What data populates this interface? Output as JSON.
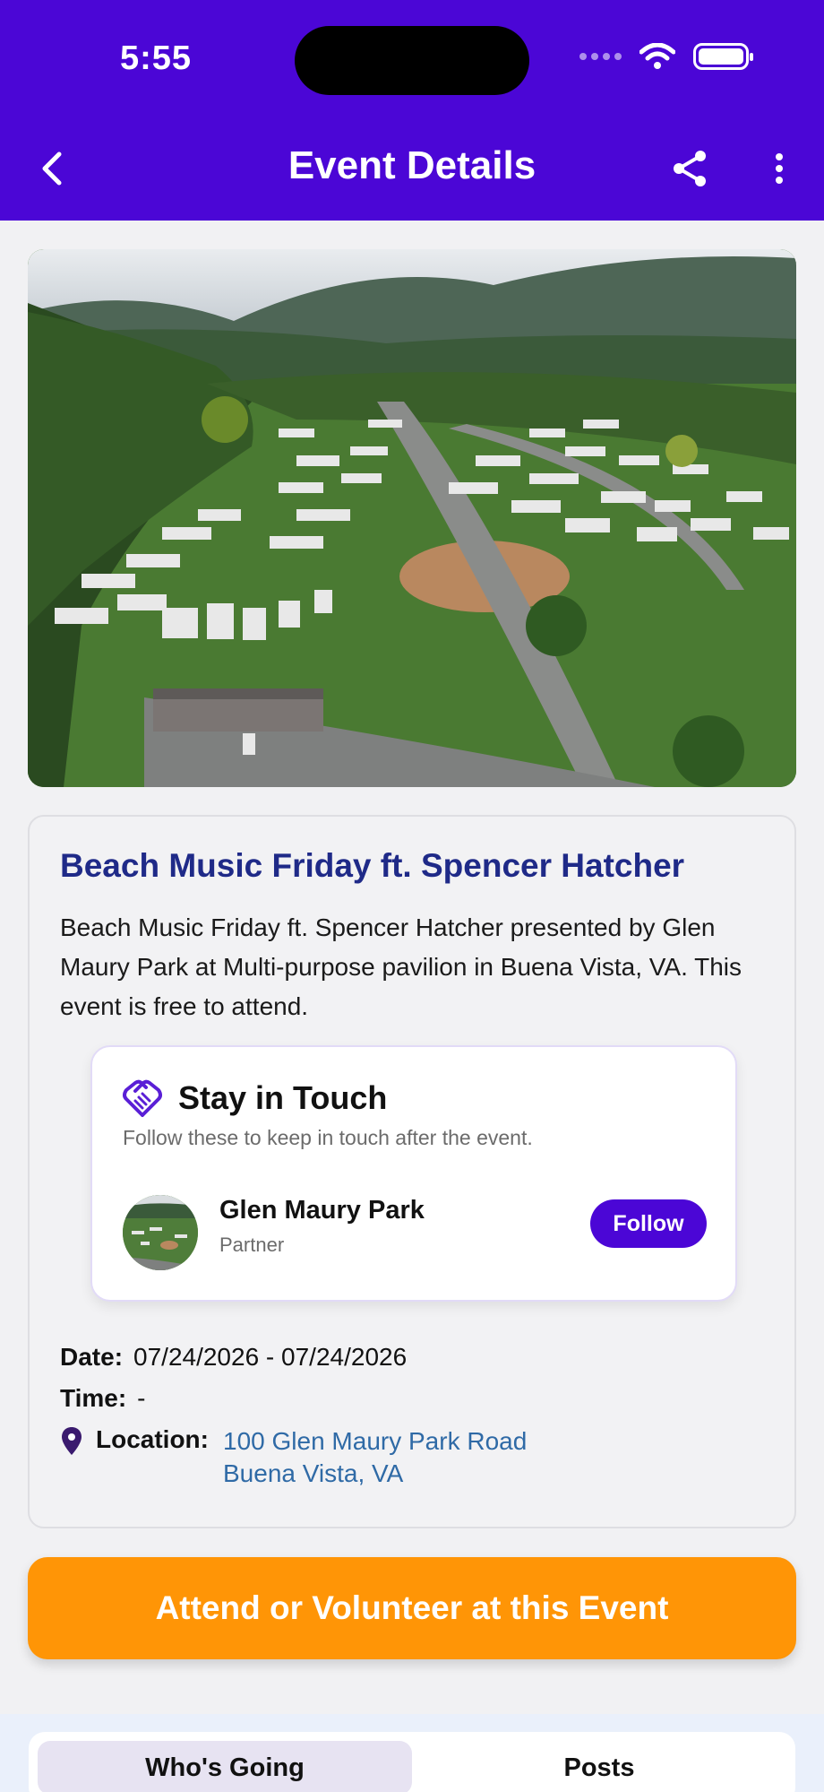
{
  "status_bar": {
    "time": "5:55"
  },
  "header": {
    "title": "Event Details"
  },
  "event": {
    "title": "Beach Music Friday ft. Spencer Hatcher",
    "description": "Beach Music Friday ft. Spencer Hatcher presented by Glen Maury Park at Multi-purpose pavilion in Buena Vista, VA. This event is free to attend."
  },
  "stay_in_touch": {
    "title": "Stay in Touch",
    "subtitle": "Follow these to keep in touch after the event.",
    "partner": {
      "name": "Glen Maury Park",
      "role": "Partner",
      "follow_label": "Follow"
    }
  },
  "details": {
    "date_label": "Date:",
    "date_value": "07/24/2026 - 07/24/2026",
    "time_label": "Time:",
    "time_value": "-",
    "location_label": "Location:",
    "location_line1": "100 Glen Maury Park Road",
    "location_line2": "Buena Vista, VA"
  },
  "cta": {
    "label": "Attend or Volunteer at this Event"
  },
  "tabs": [
    {
      "label": "Who's Going",
      "active": true
    },
    {
      "label": "Posts",
      "active": false
    }
  ],
  "colors": {
    "primary": "#4b06d6",
    "accent": "#ff9506",
    "title_blue": "#1f2a88",
    "link": "#2f6aa6"
  }
}
